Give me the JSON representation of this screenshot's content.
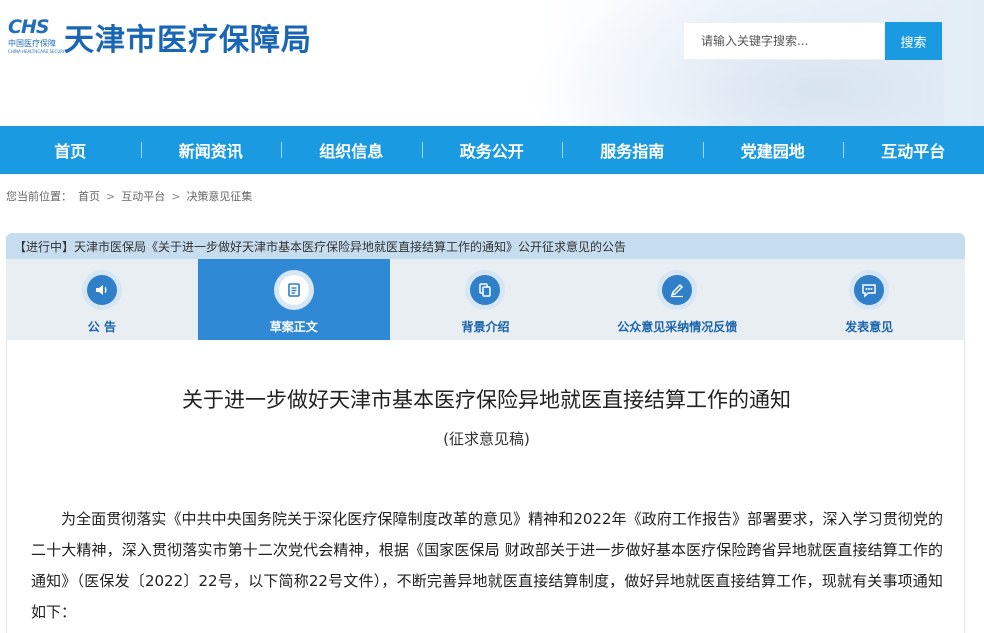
{
  "header": {
    "logo_mark": "CHS",
    "logo_cn": "中国医疗保障",
    "logo_en": "CHINA HEALTHCARE SECURITY",
    "site_title": "天津市医疗保障局"
  },
  "search": {
    "placeholder": "请输入关键字搜索...",
    "button_label": "搜索"
  },
  "nav": {
    "items": [
      {
        "label": "首页"
      },
      {
        "label": "新闻资讯"
      },
      {
        "label": "组织信息"
      },
      {
        "label": "政务公开"
      },
      {
        "label": "服务指南"
      },
      {
        "label": "党建园地"
      },
      {
        "label": "互动平台"
      }
    ]
  },
  "breadcrumb": {
    "prefix": "您当前位置：",
    "items": [
      "首页",
      "互动平台",
      "决策意见征集"
    ],
    "separator": ">"
  },
  "notice": {
    "text": "【进行中】天津市医保局《关于进一步做好天津市基本医疗保险异地就医直接结算工作的通知》公开征求意见的公告"
  },
  "tabs": {
    "items": [
      {
        "label": "公  告",
        "icon": "speaker-icon"
      },
      {
        "label": "草案正文",
        "icon": "document-icon"
      },
      {
        "label": "背景介绍",
        "icon": "copy-icon"
      },
      {
        "label": "公众意见采纳情况反馈",
        "icon": "pen-icon"
      },
      {
        "label": "发表意见",
        "icon": "chat-icon"
      }
    ],
    "active_index": 1
  },
  "document": {
    "title": "关于进一步做好天津市基本医疗保险异地就医直接结算工作的通知",
    "subtitle": "(征求意见稿)",
    "body": "为全面贯彻落实《中共中央国务院关于深化医疗保障制度改革的意见》精神和2022年《政府工作报告》部署要求，深入学习贯彻党的二十大精神，深入贯彻落实市第十二次党代会精神，根据《国家医保局 财政部关于进一步做好基本医疗保险跨省异地就医直接结算工作的通知》（医保发〔2022〕22号，以下简称22号文件），不断完善异地就医直接结算制度，做好异地就医直接结算工作，现就有关事项通知如下："
  },
  "colors": {
    "nav_bg": "#1a9ae1",
    "active_tab": "#3089d4",
    "notice_bg": "#c6dcef",
    "brand_blue": "#1866b4"
  }
}
